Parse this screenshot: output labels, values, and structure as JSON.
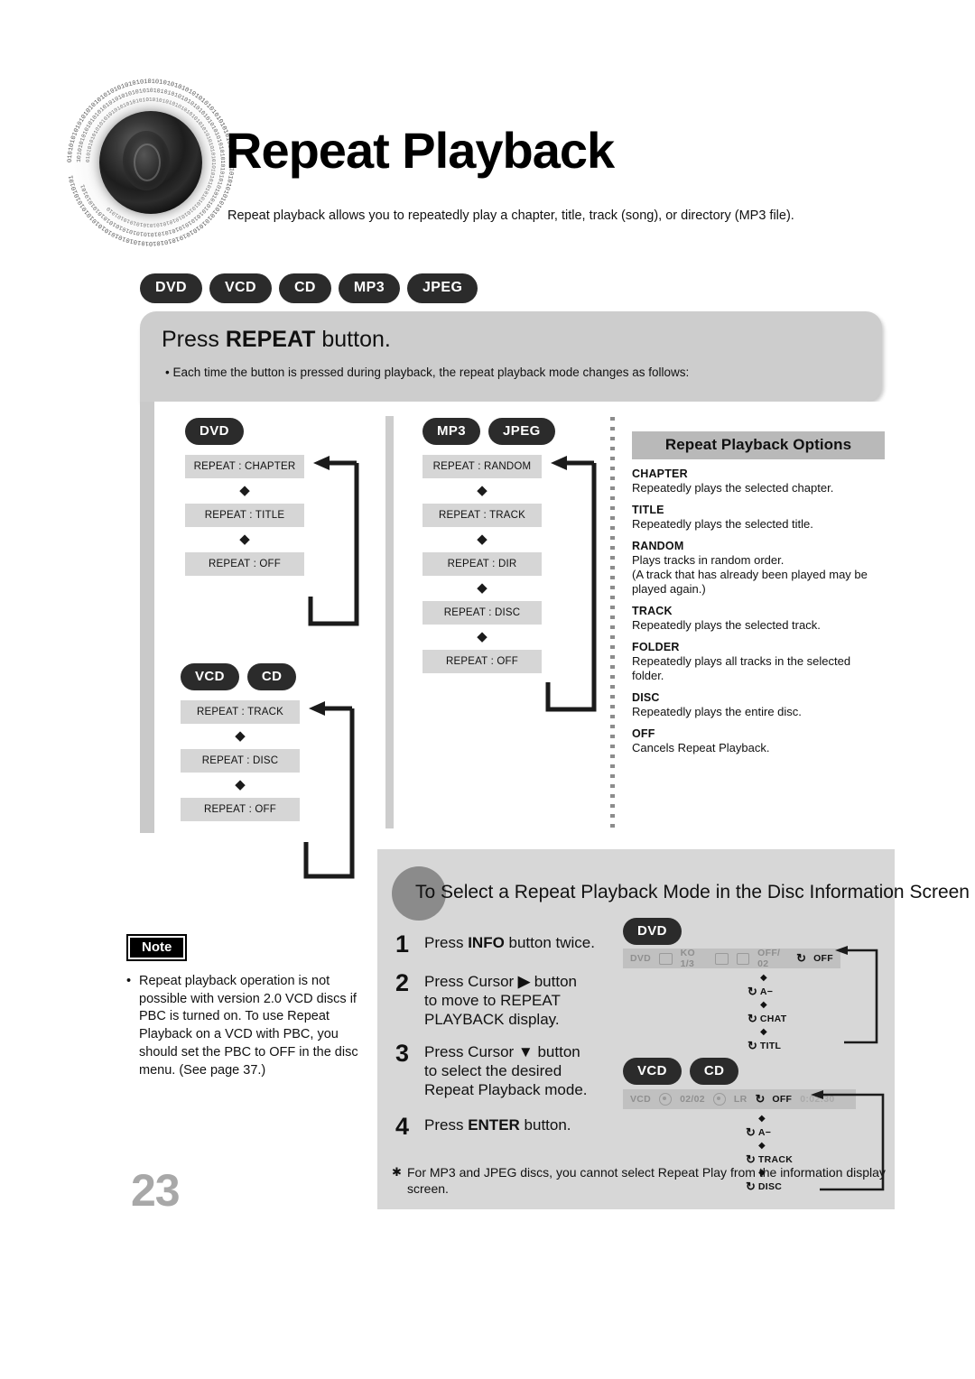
{
  "page": {
    "title": "Repeat Playback",
    "subtitle": "Repeat playback allows you to repeatedly play a chapter, title, track (song), or directory (MP3 file).",
    "page_number": "23"
  },
  "disc_badges": [
    "DVD",
    "VCD",
    "CD",
    "MP3",
    "JPEG"
  ],
  "repeat_panel": {
    "heading_prefix": "Press ",
    "heading_bold": "REPEAT",
    "heading_suffix": " button.",
    "bullet": "• Each time the button is pressed during playback, the repeat playback mode changes as follows:"
  },
  "flows": {
    "dvd": {
      "badges": [
        "DVD"
      ],
      "steps": [
        "REPEAT : CHAPTER",
        "REPEAT : TITLE",
        "REPEAT : OFF"
      ]
    },
    "vcd_cd": {
      "badges": [
        "VCD",
        "CD"
      ],
      "steps": [
        "REPEAT : TRACK",
        "REPEAT : DISC",
        "REPEAT : OFF"
      ]
    },
    "mp3_jpeg": {
      "badges": [
        "MP3",
        "JPEG"
      ],
      "steps": [
        "REPEAT : RANDOM",
        "REPEAT : TRACK",
        "REPEAT : DIR",
        "REPEAT : DISC",
        "REPEAT : OFF"
      ]
    },
    "arrow_glyph": "◆"
  },
  "options": {
    "title": "Repeat Playback Options",
    "items": [
      {
        "term": "CHAPTER",
        "definition": "Repeatedly plays the selected chapter."
      },
      {
        "term": "TITLE",
        "definition": "Repeatedly plays the selected title."
      },
      {
        "term": "RANDOM",
        "definition": "Plays tracks in random order.\n(A track that has already been played may be played again.)"
      },
      {
        "term": "TRACK",
        "definition": "Repeatedly plays the selected track."
      },
      {
        "term": "FOLDER",
        "definition": "Repeatedly plays all tracks in the selected folder."
      },
      {
        "term": "DISC",
        "definition": "Repeatedly plays the entire disc."
      },
      {
        "term": "OFF",
        "definition": "Cancels Repeat Playback."
      }
    ]
  },
  "note": {
    "label": "Note",
    "text": "Repeat playback operation is not possible with version 2.0 VCD discs if PBC is turned on. To use Repeat Playback on a VCD with PBC, you should set the PBC to OFF in the disc menu. (See page 37.)"
  },
  "disc_info": {
    "title": "To Select a Repeat Playback Mode in the Disc Information Screen",
    "steps": [
      {
        "num": "1",
        "prefix": "Press ",
        "bold": "INFO",
        "suffix": " button twice."
      },
      {
        "num": "2",
        "prefix": "Press Cursor ",
        "bold": "▶",
        "suffix": " button\nto move to REPEAT\nPLAYBACK display."
      },
      {
        "num": "3",
        "prefix": "Press Cursor ",
        "bold": "▼",
        "suffix": " button\nto select the desired\nRepeat Playback mode."
      },
      {
        "num": "4",
        "prefix": "Press ",
        "bold": "ENTER",
        "suffix": " button."
      }
    ],
    "footnote": "For MP3 and JPEG discs, you cannot select Repeat Play from the information display screen.",
    "dvd_osd": {
      "badges": [
        "DVD"
      ],
      "bar_fields": [
        "DVD",
        "KO 1/3",
        "OFF/ 02"
      ],
      "bar_active": "OFF",
      "chain": [
        "A−",
        "CHAT",
        "TITL"
      ]
    },
    "vcd_cd_osd": {
      "badges": [
        "VCD",
        "CD"
      ],
      "bar_fields": [
        "VCD",
        "02/02",
        "LR"
      ],
      "bar_active": "OFF",
      "bar_time": "0:02:30",
      "chain": [
        "A−",
        "TRACK",
        "DISC"
      ]
    }
  },
  "colors": {
    "panel_gray": "#cdcdcd",
    "box_gray": "#d6d6d6",
    "badge_black": "#2b2b2b",
    "page_number_gray": "#a8a8a8"
  }
}
